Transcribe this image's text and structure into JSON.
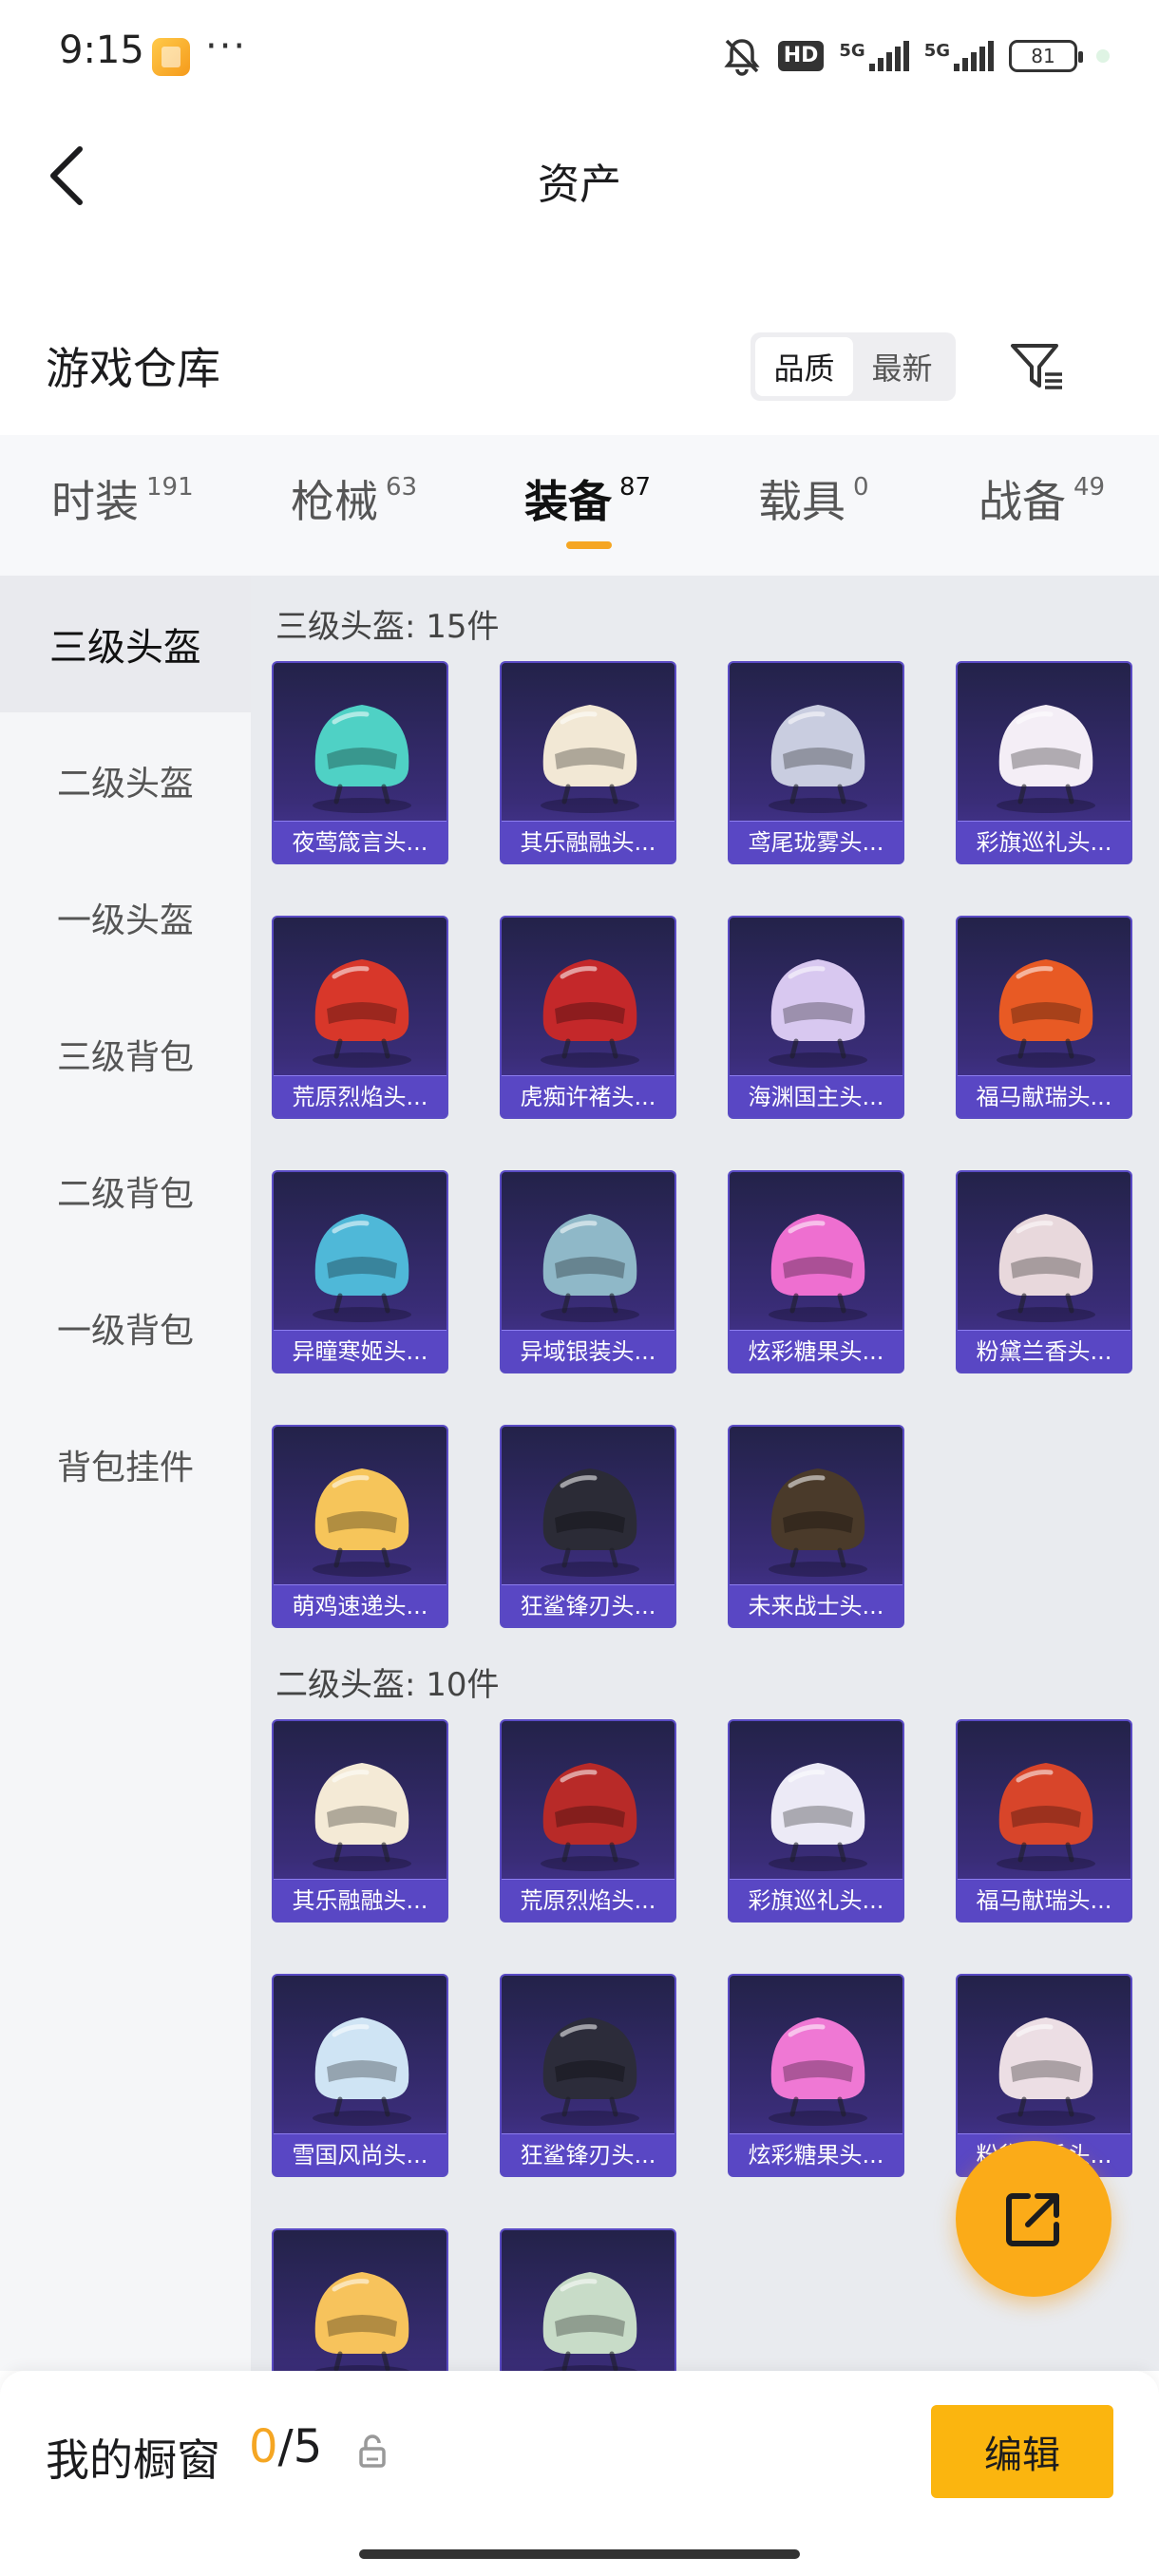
{
  "status_bar": {
    "time": "9:15",
    "dots": "···",
    "hd": "HD",
    "net1": "5G",
    "net2": "5G",
    "battery": "81",
    "icons": [
      "app-icon",
      "mute-icon",
      "signal-icon",
      "battery-icon"
    ]
  },
  "nav": {
    "title": "资产",
    "back_icon": "back-arrow-icon"
  },
  "warehouse": {
    "title": "游戏仓库",
    "sort_options": [
      "品质",
      "最新"
    ],
    "sort_selected": "品质",
    "filter_icon": "filter-icon"
  },
  "tabs": [
    {
      "label": "时装",
      "count": "191"
    },
    {
      "label": "枪械",
      "count": "63"
    },
    {
      "label": "装备",
      "count": "87",
      "active": true
    },
    {
      "label": "载具",
      "count": "0"
    },
    {
      "label": "战备",
      "count": "49"
    }
  ],
  "side_menu": [
    "三级头盔",
    "二级头盔",
    "一级头盔",
    "三级背包",
    "二级背包",
    "一级背包",
    "背包挂件"
  ],
  "side_menu_active": "三级头盔",
  "groups": [
    {
      "title": "三级头盔: 15件",
      "items": [
        {
          "name": "夜莺箴言头...",
          "color": "#4fd1c5"
        },
        {
          "name": "其乐融融头...",
          "color": "#f2e8d5"
        },
        {
          "name": "鸢尾珑雾头...",
          "color": "#c9cde0"
        },
        {
          "name": "彩旗巡礼头...",
          "color": "#f4eef6"
        },
        {
          "name": "荒原烈焰头...",
          "color": "#d8372a"
        },
        {
          "name": "虎痴许褚头...",
          "color": "#c4282a"
        },
        {
          "name": "海渊国主头...",
          "color": "#d8c8f0"
        },
        {
          "name": "福马献瑞头...",
          "color": "#e85a24"
        },
        {
          "name": "异瞳寒姬头...",
          "color": "#4fb8d8"
        },
        {
          "name": "异域银装头...",
          "color": "#8fb8c8"
        },
        {
          "name": "炫彩糖果头...",
          "color": "#ee6fd0"
        },
        {
          "name": "粉黛兰香头...",
          "color": "#e8d8dc"
        },
        {
          "name": "萌鸡速递头...",
          "color": "#f6c55a"
        },
        {
          "name": "狂鲨锋刃头...",
          "color": "#2b2b36"
        },
        {
          "name": "未来战士头...",
          "color": "#4a3a2a"
        }
      ]
    },
    {
      "title": "二级头盔: 10件",
      "items": [
        {
          "name": "其乐融融头...",
          "color": "#f4ead6"
        },
        {
          "name": "荒原烈焰头...",
          "color": "#b82a28"
        },
        {
          "name": "彩旗巡礼头...",
          "color": "#eceaf6"
        },
        {
          "name": "福马献瑞头...",
          "color": "#d8452a"
        },
        {
          "name": "雪国风尚头...",
          "color": "#cfe4f4"
        },
        {
          "name": "狂鲨锋刃头...",
          "color": "#2c2c3a"
        },
        {
          "name": "炫彩糖果头...",
          "color": "#ef78d4"
        },
        {
          "name": "粉黛兰香头...",
          "color": "#ecdee4"
        },
        {
          "name": "",
          "color": "#f7c35c"
        },
        {
          "name": "",
          "color": "#c8dcc8"
        }
      ]
    }
  ],
  "fab_icon": "share-icon",
  "showcase": {
    "title": "我的橱窗",
    "used": "0",
    "sep": "/",
    "total": "5",
    "edit_label": "编辑",
    "lock_icon": "lock-icon"
  },
  "colors": {
    "accent": "#fbb50f",
    "card_bg": "#3a2d78",
    "card_label": "#5947c4"
  }
}
